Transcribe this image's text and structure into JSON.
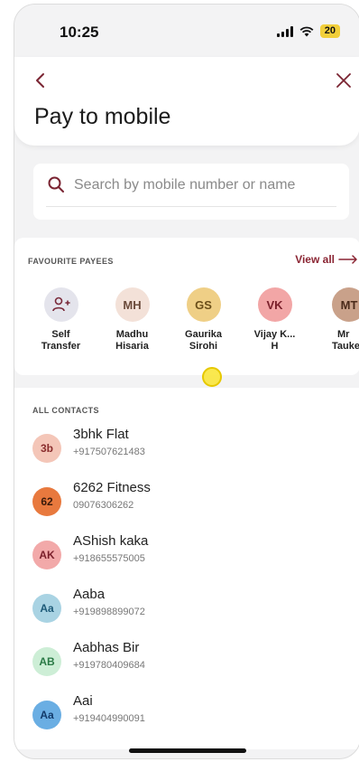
{
  "status_bar": {
    "time": "10:25",
    "battery": "20"
  },
  "header": {
    "title": "Pay to mobile"
  },
  "search": {
    "placeholder": "Search by mobile number or name"
  },
  "favourites": {
    "label": "FAVOURITE PAYEES",
    "view_all": "View all",
    "payees": [
      {
        "initials": "",
        "icon": "add-user-icon",
        "line1": "Self",
        "line2": "Transfer",
        "bg": "#e4e4ec",
        "fg": "#7a2a3a"
      },
      {
        "initials": "MH",
        "line1": "Madhu",
        "line2": "Hisaria",
        "bg": "#f3e1d8",
        "fg": "#6a4a3a"
      },
      {
        "initials": "GS",
        "line1": "Gaurika",
        "line2": "Sirohi",
        "bg": "#efcf86",
        "fg": "#6b4f1a"
      },
      {
        "initials": "VK",
        "line1": "Vijay K...",
        "line2": "H",
        "bg": "#f2a6a6",
        "fg": "#7a1f2a"
      },
      {
        "initials": "MT",
        "line1": "Mr",
        "line2": "Taukee",
        "bg": "#c9a18a",
        "fg": "#4a2a1a"
      }
    ]
  },
  "contacts": {
    "label": "ALL CONTACTS",
    "items": [
      {
        "initials": "3b",
        "name": "3bhk Flat",
        "phone": "+917507621483",
        "bg": "#f4c6b8",
        "fg": "#8a2c2c"
      },
      {
        "initials": "62",
        "name": "6262 Fitness",
        "phone": "09076306262",
        "bg": "#e8793e",
        "fg": "#3a1a0a"
      },
      {
        "initials": "AK",
        "name": "AShish kaka",
        "phone": "+918655575005",
        "bg": "#f2a9a9",
        "fg": "#7a1f2a"
      },
      {
        "initials": "Aa",
        "name": "Aaba",
        "phone": "+919898899072",
        "bg": "#a9d3e3",
        "fg": "#1d5a78"
      },
      {
        "initials": "AB",
        "name": "Aabhas Bir",
        "phone": "+919780409684",
        "bg": "#cdeed6",
        "fg": "#2a7a46"
      },
      {
        "initials": "Aa",
        "name": "Aai",
        "phone": "+919404990091",
        "bg": "#6aaee3",
        "fg": "#123a6a"
      }
    ]
  }
}
